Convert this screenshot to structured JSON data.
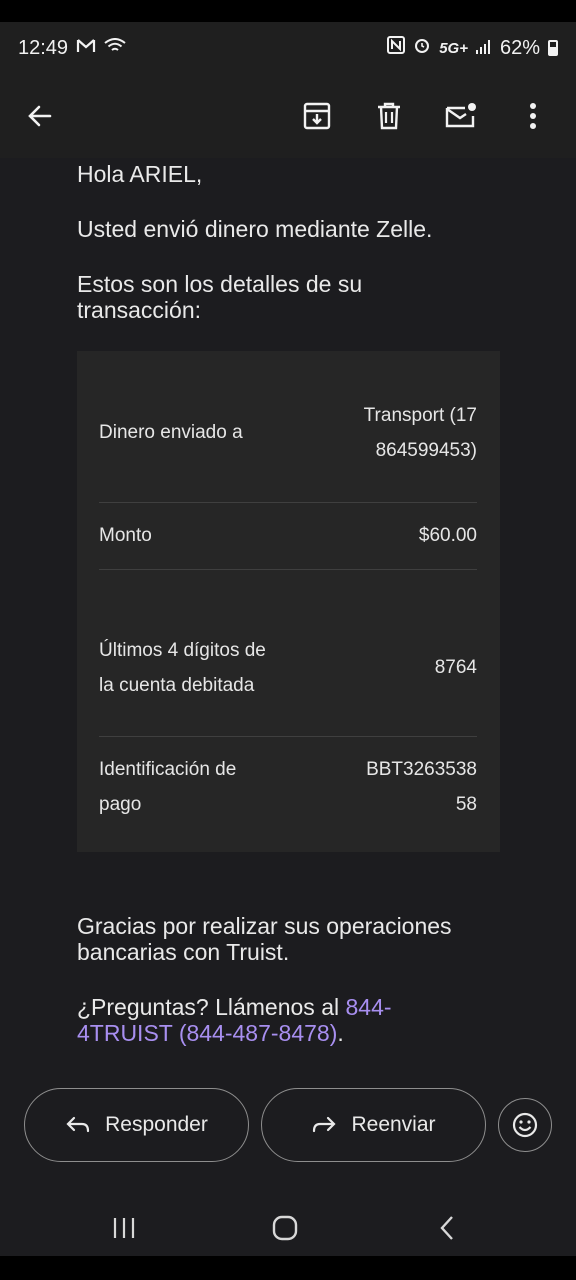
{
  "status": {
    "time": "12:49",
    "network": "5G+",
    "battery": "62%"
  },
  "email": {
    "greeting": "Hola ARIEL,",
    "line1": "Usted envió dinero mediante Zelle.",
    "line2": "Estos son los detalles de su transacción:",
    "details": [
      {
        "label": "Dinero enviado a",
        "value": "Transport (17864599453)"
      },
      {
        "label": "Monto",
        "value": "$60.00"
      },
      {
        "label": "Últimos 4 dígitos de la cuenta debitada",
        "value": "8764"
      },
      {
        "label": "Identificación de pago",
        "value": "BBT326353858"
      }
    ],
    "thanks": "Gracias por realizar sus operaciones bancarias con Truist.",
    "questions_prefix": "¿Preguntas? Llámenos al ",
    "phone_link": "844-4TRUIST (844-487-8478)",
    "questions_suffix": "."
  },
  "actions": {
    "reply": "Responder",
    "forward": "Reenviar"
  },
  "icons": {
    "back": "arrow-left-icon",
    "archive": "archive-icon",
    "delete": "trash-icon",
    "unread": "mark-unread-icon",
    "more": "more-vert-icon",
    "reply": "reply-icon",
    "forward": "forward-icon",
    "emoji": "emoji-icon"
  },
  "colors": {
    "background": "#1c1c1f",
    "link": "#a88ff0",
    "card": "#262626"
  }
}
